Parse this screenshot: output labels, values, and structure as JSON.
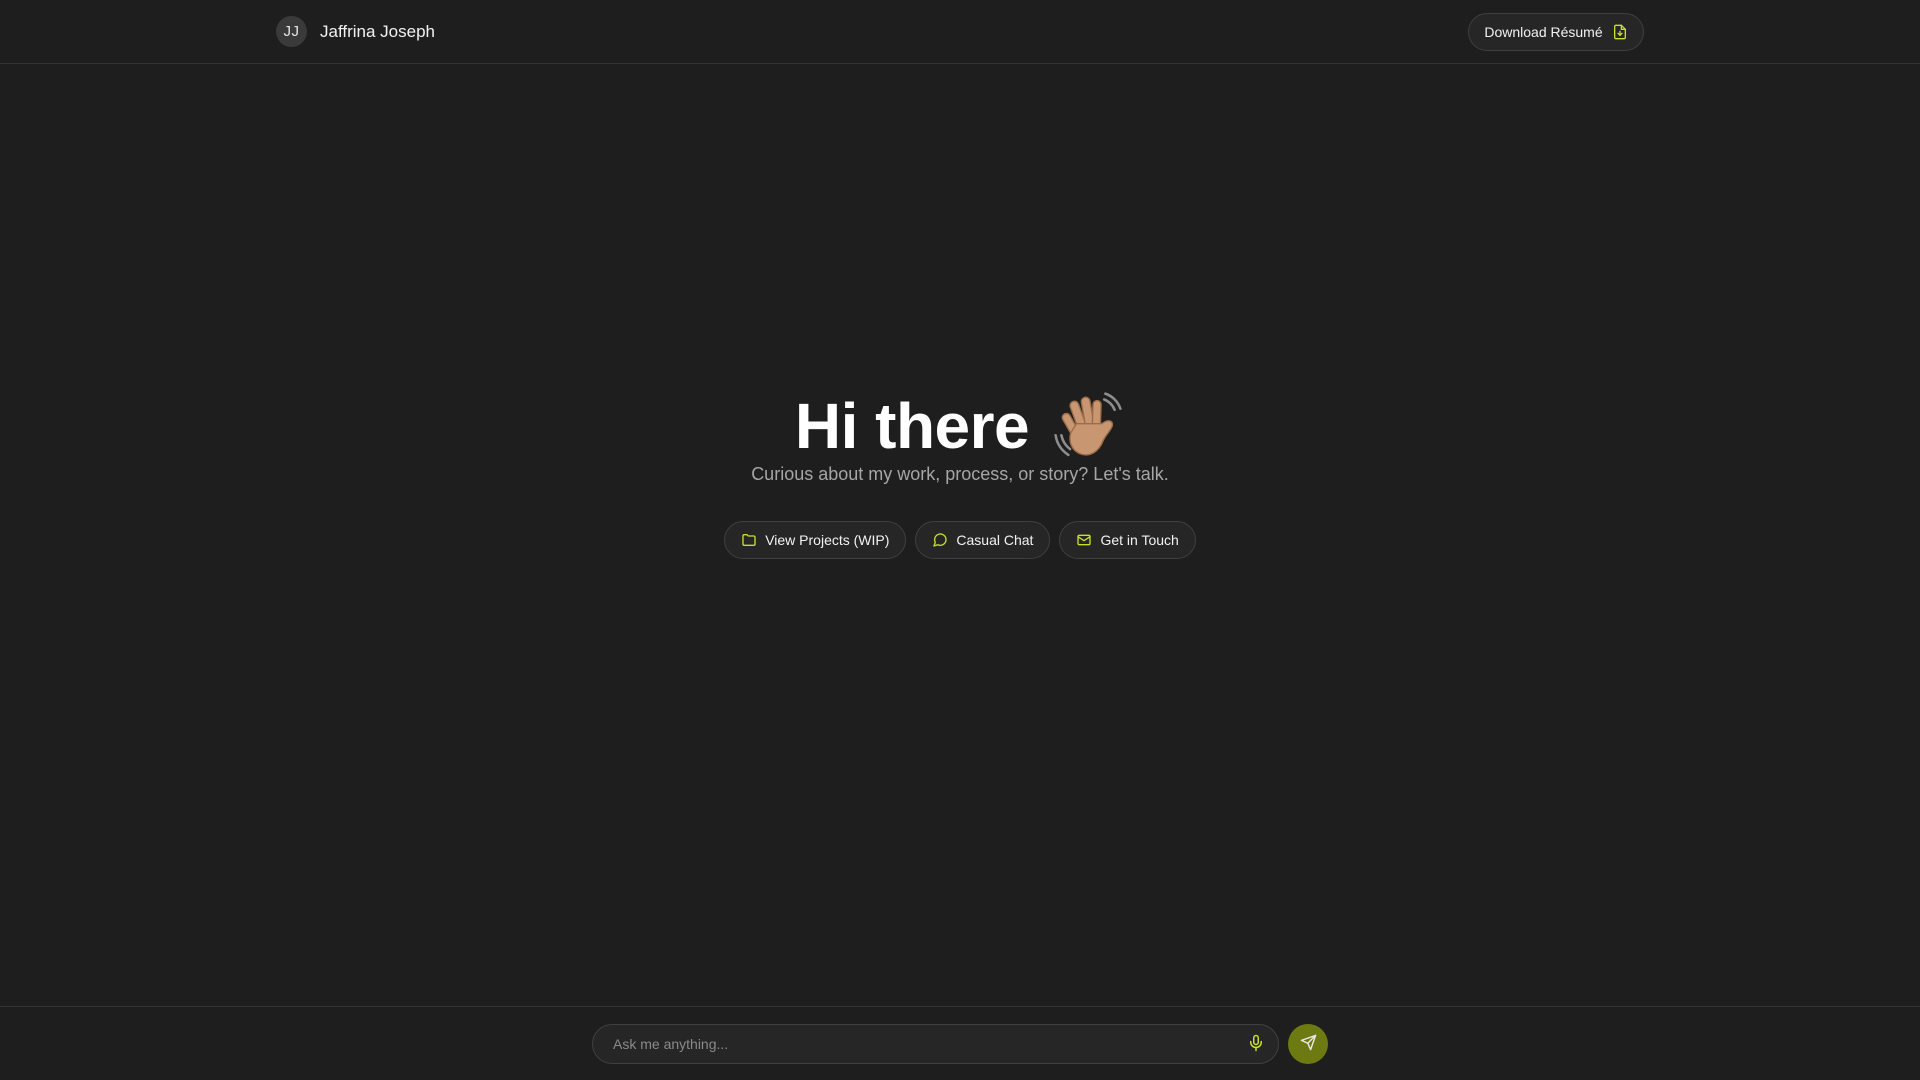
{
  "header": {
    "avatar_initials": "JJ",
    "name": "Jaffrina Joseph",
    "resume_label": "Download Résumé",
    "resume_icon": "file-download-icon"
  },
  "hero": {
    "title": "Hi there",
    "wave_icon": "waving-hand-emoji",
    "subtitle": "Curious about my work, process, or story? Let's talk."
  },
  "actions": [
    {
      "label": "View Projects (WIP)",
      "icon": "folder-icon"
    },
    {
      "label": "Casual Chat",
      "icon": "chat-bubble-icon"
    },
    {
      "label": "Get in Touch",
      "icon": "mail-icon"
    }
  ],
  "chat": {
    "placeholder": "Ask me anything...",
    "value": "",
    "mic_icon": "microphone-icon",
    "send_icon": "send-icon"
  },
  "colors": {
    "background": "#1e1e1e",
    "accent": "#c8e02a",
    "send_button": "#6d7a12",
    "muted_text": "#a6a6a6"
  }
}
